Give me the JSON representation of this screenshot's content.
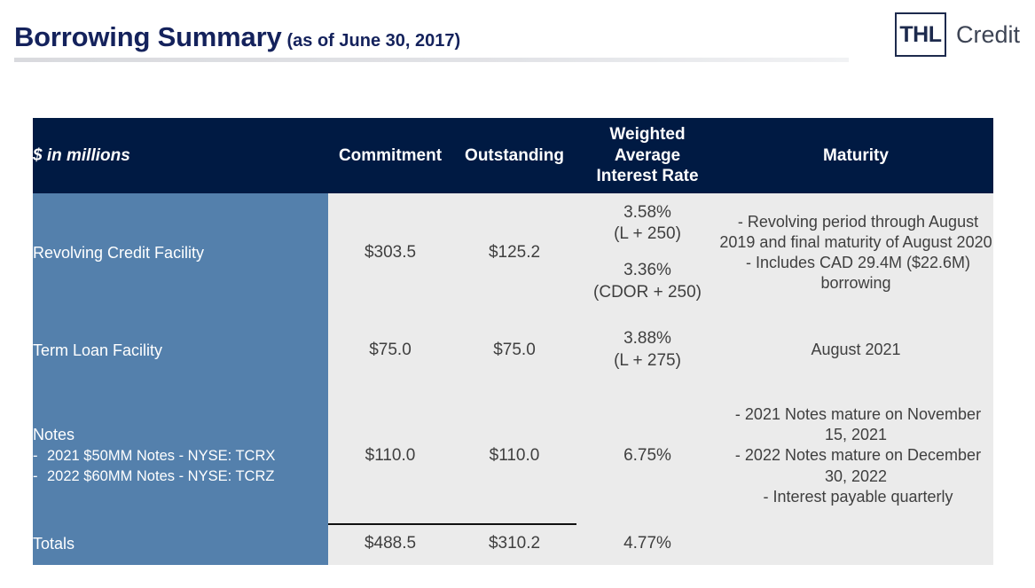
{
  "header": {
    "title": "Borrowing Summary",
    "subtitle": "(as of June 30, 2017)"
  },
  "logo": {
    "mark": "THL",
    "word": "Credit"
  },
  "table": {
    "columns": [
      "$ in millions",
      "Commitment",
      "Outstanding",
      "Weighted Average Interest Rate",
      "Maturity"
    ],
    "column_rate_lines": [
      "Weighted",
      "Average",
      "Interest Rate"
    ],
    "rows": [
      {
        "label": "Revolving Credit Facility",
        "commitment": "$303.5",
        "outstanding": "$125.2",
        "rate_primary": "3.58%",
        "rate_primary_basis": "(L + 250)",
        "rate_secondary": "3.36%",
        "rate_secondary_basis": "(CDOR + 250)",
        "maturity_bullets": [
          "Revolving period through August 2019 and final maturity of August 2020",
          "Includes CAD 29.4M ($22.6M) borrowing"
        ]
      },
      {
        "label": "Term Loan Facility",
        "commitment": "$75.0",
        "outstanding": "$75.0",
        "rate_primary": "3.88%",
        "rate_primary_basis": "(L + 275)",
        "maturity_text": "August 2021"
      },
      {
        "label": "Notes",
        "sub_items": [
          "2021 $50MM Notes - NYSE: TCRX",
          "2022 $60MM Notes - NYSE: TCRZ"
        ],
        "commitment": "$110.0",
        "outstanding": "$110.0",
        "rate_primary": "6.75%",
        "maturity_bullets": [
          "2021 Notes mature on November 15, 2021",
          "2022 Notes mature on December 30, 2022",
          "Interest payable quarterly"
        ]
      }
    ],
    "totals": {
      "label": "Totals",
      "commitment": "$488.5",
      "outstanding": "$310.2",
      "rate": "4.77%",
      "maturity": ""
    }
  },
  "colors": {
    "header_navy": "#001a43",
    "row_blue": "#5480ac",
    "cell_gray": "#ebebeb",
    "title_navy": "#14225c"
  }
}
